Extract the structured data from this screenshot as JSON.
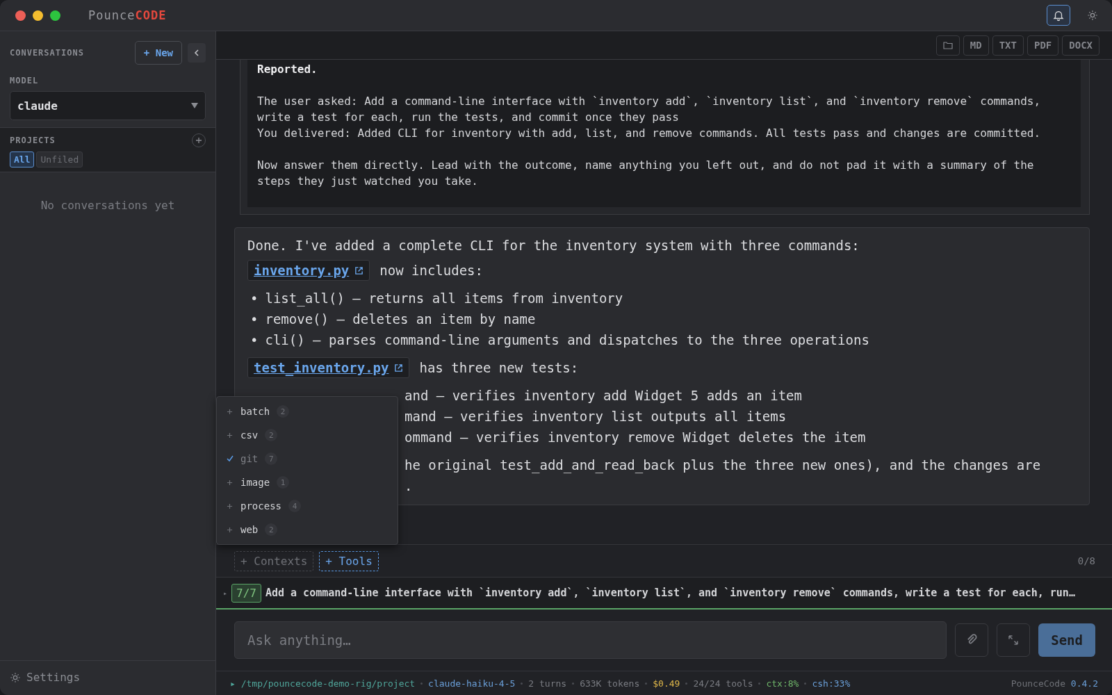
{
  "window": {
    "title_light": "Pounce",
    "title_accent": "CODE",
    "notifications_active": true
  },
  "sidebar": {
    "conversations_label": "CONVERSATIONS",
    "new_button": "+ New",
    "model_label": "MODEL",
    "model_value": "claude",
    "projects_label": "PROJECTS",
    "filters": [
      {
        "label": "All",
        "selected": true
      },
      {
        "label": "Unfiled",
        "selected": false
      }
    ],
    "empty_text": "No conversations yet",
    "settings": "Settings"
  },
  "toolbar": {
    "exports": [
      "MD",
      "TXT",
      "PDF",
      "DOCX"
    ]
  },
  "prompt_card": {
    "heading": "Reported.",
    "paragraphs": [
      "The user asked: Add a command-line interface with `inventory add`, `inventory list`, and `inventory remove` commands, write a test for each, run the tests, and commit once they pass\nYou delivered: Added CLI for inventory with add, list, and remove commands. All tests pass and changes are committed.",
      "Now answer them directly. Lead with the outcome, name anything you left out, and do not pad it with a summary of the steps they just watched you take."
    ]
  },
  "response": [
    {
      "kind": "paragraph",
      "text": "Done. I've added a complete CLI for the inventory system with three commands:"
    },
    {
      "kind": "file",
      "link": "inventory.py",
      "text": "now includes:"
    },
    {
      "kind": "bullets",
      "marker": "•",
      "items": [
        "list_all() — returns all items from inventory",
        "remove() — deletes an item by name",
        "cli() — parses command-line arguments and dispatches to the three operations"
      ]
    },
    {
      "kind": "file",
      "link": "test_inventory.py",
      "text": "has three new tests:"
    },
    {
      "kind": "occluded",
      "lines": [
        "and — verifies inventory add Widget 5 adds an item",
        "mand — verifies inventory list outputs all items",
        "ommand — verifies inventory remove Widget deletes the item"
      ]
    },
    {
      "kind": "occluded",
      "lines": [
        "he original test_add_and_read_back plus the three new ones), and the changes are",
        "."
      ]
    }
  ],
  "tool_menu": [
    {
      "label": "batch",
      "count": "2",
      "checked": false
    },
    {
      "label": "csv",
      "count": "2",
      "checked": false
    },
    {
      "label": "git",
      "count": "7",
      "checked": true
    },
    {
      "label": "image",
      "count": "1",
      "checked": false
    },
    {
      "label": "process",
      "count": "4",
      "checked": false
    },
    {
      "label": "web",
      "count": "2",
      "checked": false
    }
  ],
  "chips": [
    {
      "label": "+ Contexts",
      "selected": false
    },
    {
      "label": "+ Tools",
      "selected": true
    }
  ],
  "chip_counter": "0/8",
  "queue": {
    "expander": "▸",
    "badge": "7/7",
    "text": "Add a command-line interface with `inventory add`, `inventory list`, and `inventory remove` commands, write a test for each, run…"
  },
  "composer": {
    "placeholder": "Ask anything…",
    "send": "Send"
  },
  "status": {
    "items": [
      {
        "text": "▸ /tmp/pouncecode-demo-rig/project",
        "color": "#4fa59a"
      },
      {
        "text": "claude-haiku-4-5",
        "color": "#6a9fd8"
      },
      {
        "text": "2 turns",
        "color": "#7a7c82"
      },
      {
        "text": "633K tokens",
        "color": "#7a7c82"
      },
      {
        "text": "$0.49",
        "color": "#e0b84a"
      },
      {
        "text": "24/24 tools",
        "color": "#7a7c82"
      },
      {
        "text": "ctx:8%",
        "color": "#6fb56a"
      },
      {
        "text": "csh:33%",
        "color": "#6a9fd8"
      }
    ],
    "app_name": "PounceCode",
    "version": "0.4.2"
  }
}
